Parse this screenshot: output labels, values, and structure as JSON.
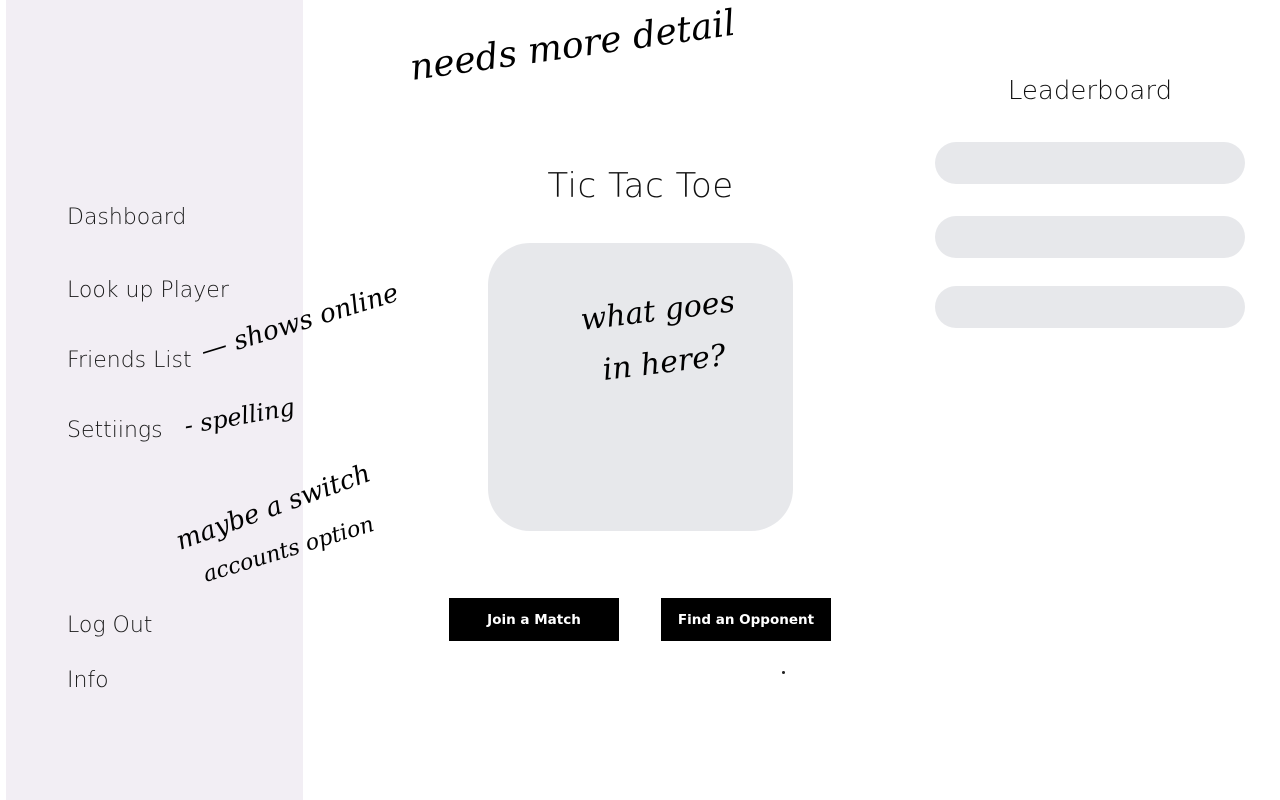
{
  "sidebar": {
    "items": [
      {
        "label": "Dashboard"
      },
      {
        "label": "Look up Player"
      },
      {
        "label": "Friends List"
      },
      {
        "label": "Settiings"
      }
    ],
    "bottom_items": [
      {
        "label": "Log Out"
      },
      {
        "label": "Info"
      }
    ]
  },
  "main": {
    "title": "Tic Tac Toe",
    "buttons": {
      "join_label": "Join a Match",
      "find_label": "Find an Opponent"
    }
  },
  "leaderboard": {
    "title": "Leaderboard",
    "row_count": 3
  },
  "annotations": {
    "top_note": "needs more detail",
    "board_note_line1": "what goes",
    "board_note_line2": "in here?",
    "friends_note": "— shows online",
    "settings_note": "- spelling",
    "switch_note_line1": "maybe a switch",
    "switch_note_line2": "accounts option"
  },
  "colors": {
    "sidebar_bg": "#f2eef4",
    "placeholder_gray": "#e7e8eb",
    "button_bg": "#000000",
    "button_text": "#ffffff"
  }
}
